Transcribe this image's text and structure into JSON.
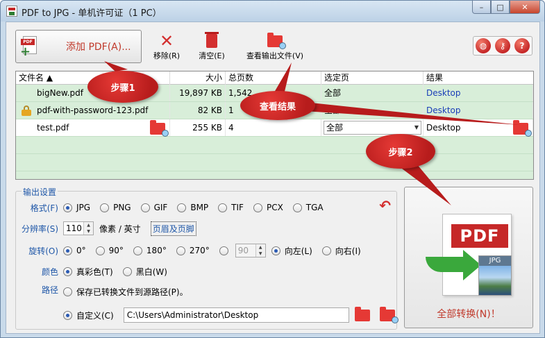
{
  "window": {
    "title": "PDF to JPG - 单机许可证（1 PC）",
    "minimize": "–",
    "maximize": "□",
    "close": "✕"
  },
  "toolbar": {
    "add_label": "添加 PDF(A)...",
    "remove_label": "移除(R)",
    "clear_label": "清空(E)",
    "view_output_label": "查看输出文件(V)",
    "round_buttons": [
      "web-icon",
      "key-icon",
      "help-icon"
    ]
  },
  "table": {
    "headers": {
      "name": "文件名 ▲",
      "size": "大小",
      "pages": "总页数",
      "selected": "选定页",
      "result": "结果"
    },
    "rows": [
      {
        "name": "bigNew.pdf",
        "size": "19,897 KB",
        "pages": "1,542",
        "selected": "全部",
        "result": "Desktop"
      },
      {
        "name": "pdf-with-password-123.pdf",
        "size": "82 KB",
        "pages": "1",
        "selected": "全部",
        "result": "Desktop"
      },
      {
        "name": "test.pdf",
        "size": "255 KB",
        "pages": "4",
        "selected": "全部",
        "result": "Desktop"
      }
    ]
  },
  "settings": {
    "title": "输出设置",
    "format_label": "格式(F)",
    "formats": [
      "JPG",
      "PNG",
      "GIF",
      "BMP",
      "TIF",
      "PCX",
      "TGA"
    ],
    "selected_format": "JPG",
    "resolution_label": "分辨率(S)",
    "resolution_value": "110",
    "resolution_unit": "像素 / 英寸",
    "header_footer": "页眉及页脚",
    "rotate_label": "旋转(O)",
    "rotations": [
      "0°",
      "90°",
      "180°",
      "270°"
    ],
    "custom_angle": "90",
    "rotate_left": "向左(L)",
    "rotate_right": "向右(I)",
    "color_label": "颜色",
    "color_true": "真彩色(T)",
    "color_bw": "黑白(W)",
    "path_label": "路径",
    "path_source": "保存已转换文件到源路径(P)。",
    "path_custom": "自定义(C)",
    "path_value": "C:\\Users\\Administrator\\Desktop"
  },
  "convert": {
    "label": "全部转换(N)！",
    "pdf_tag": "PDF",
    "jpg_tag": "JPG"
  },
  "callouts": {
    "step1": "步骤1",
    "view_result": "查看结果",
    "step2": "步骤2"
  },
  "colors": {
    "accent_red": "#c62828",
    "row_green": "#d8eed9",
    "label_blue": "#1f57a8"
  }
}
